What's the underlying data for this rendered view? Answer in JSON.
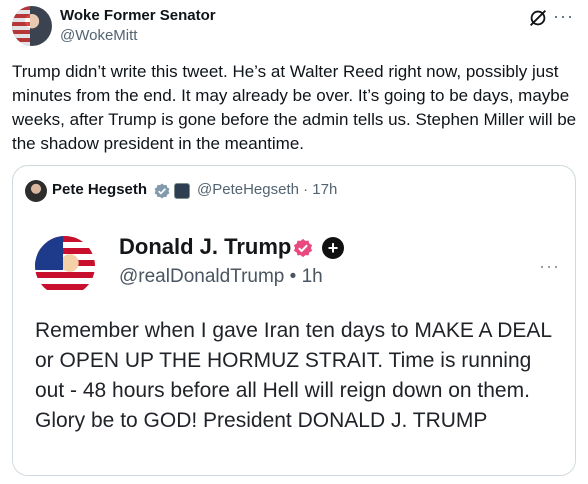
{
  "tweet": {
    "author_name": "Woke Former Senator",
    "author_handle": "@WokeMitt",
    "more_label": "···",
    "text": "Trump didn’t write this tweet. He’s at Walter Reed right now, possibly just minutes from the end. It may already be over. It’s going to be days, maybe weeks, after Trump is gone before the admin tells us. Stephen Miller will be the shadow president in the meantime."
  },
  "quote": {
    "author_name": "Pete Hegseth",
    "handle_time": "@PeteHegseth · 17h",
    "embedded_post": {
      "author_name": "Donald J. Trump",
      "handle_time": "@realDonaldTrump • 1h",
      "plus_label": "+",
      "more_label": "···",
      "text": "Remember when I gave Iran ten days to MAKE A DEAL or OPEN UP THE HORMUZ STRAIT. Time is running out - 48 hours before all Hell will reign down on them. Glory be to GOD! President DONALD J. TRUMP"
    }
  },
  "colors": {
    "verified_blue": "#1d9bf0",
    "verified_pink": "#e84a7f",
    "secondary_text": "#536471"
  }
}
